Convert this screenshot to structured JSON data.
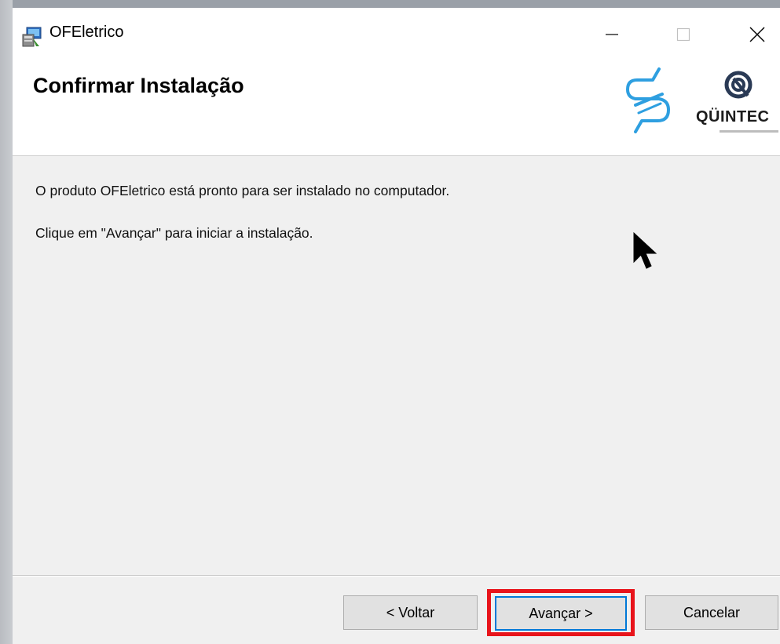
{
  "window": {
    "title": "OFEletrico",
    "icons": {
      "app": "installer-app-icon",
      "minimize": "minimize-icon",
      "maximize": "maximize-icon",
      "close": "close-icon"
    }
  },
  "header": {
    "title": "Confirmar Instalação",
    "logos": [
      {
        "name": "stylized-s-logo",
        "text": ""
      },
      {
        "name": "quintec-logo",
        "text": "QÜINTEC"
      }
    ]
  },
  "body": {
    "line1": "O produto OFEletrico está pronto para ser instalado no computador.",
    "line2": "Clique em \"Avançar\" para iniciar a instalação."
  },
  "buttons": {
    "back": "< Voltar",
    "next": "Avançar >",
    "cancel": "Cancelar"
  },
  "colors": {
    "highlight": "#e8141b",
    "focus_border": "#0078d7",
    "logo_blue": "#2e9fe0"
  }
}
